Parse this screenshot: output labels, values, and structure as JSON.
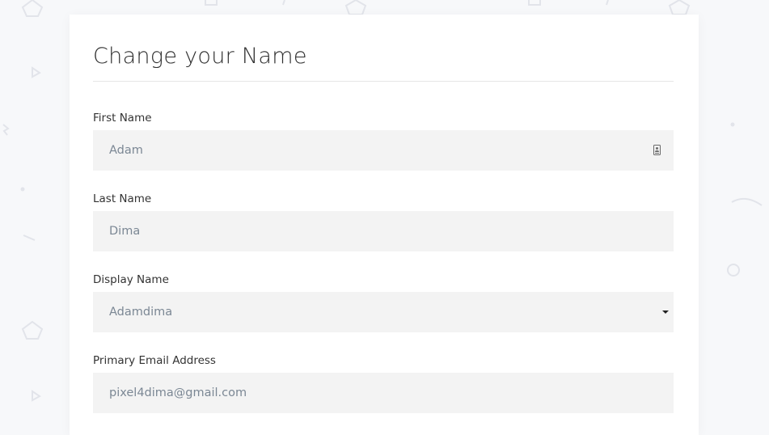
{
  "card": {
    "title": "Change your Name"
  },
  "fields": {
    "first_name": {
      "label": "First Name",
      "value": "Adam",
      "icon": "contact-card-icon"
    },
    "last_name": {
      "label": "Last Name",
      "value": "Dima"
    },
    "display_name": {
      "label": "Display Name",
      "selected": "Adamdima",
      "icon": "caret-down-icon"
    },
    "primary_email": {
      "label": "Primary Email Address",
      "value": "pixel4dima@gmail.com"
    }
  },
  "colors": {
    "page_background": "#f7f8fa",
    "card_background": "#ffffff",
    "field_background": "#f3f3f3",
    "value_text": "#7b8794",
    "label_text": "#333333"
  }
}
